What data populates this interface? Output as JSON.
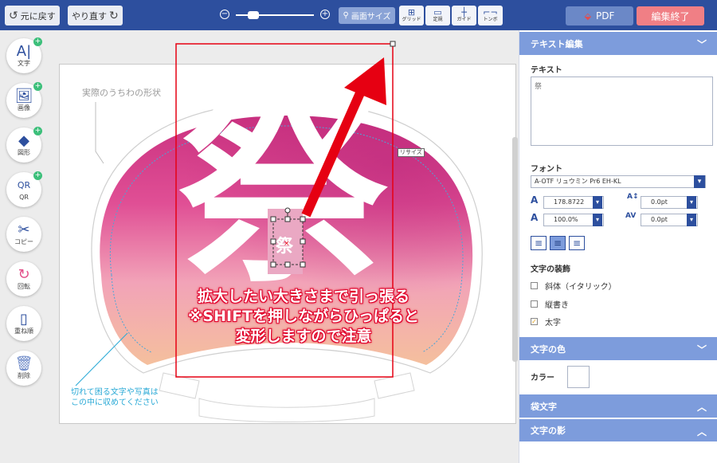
{
  "toolbar": {
    "undo": "元に戻す",
    "redo": "やり直す",
    "zoom_minus": "⊖",
    "zoom_plus": "⊕",
    "canvas_size": "画面サイズ",
    "grid": "グリッド",
    "ruler": "定規",
    "guide": "ガイド",
    "trim": "トンボ",
    "pdf": "PDF",
    "finish": "編集終了"
  },
  "left_tools": [
    {
      "glyph": "A|",
      "label": "文字",
      "plus": "+"
    },
    {
      "glyph": "🖼",
      "label": "画像",
      "plus": "+"
    },
    {
      "glyph": "◆",
      "label": "図形",
      "plus": "+"
    },
    {
      "glyph": "QR",
      "label": "QR",
      "plus": "+"
    },
    {
      "glyph": "✂",
      "label": "コピー",
      "plus": ""
    },
    {
      "glyph": "↻",
      "label": "回転",
      "plus": ""
    },
    {
      "glyph": "▯",
      "label": "重ね順",
      "plus": ""
    },
    {
      "glyph": "🗑",
      "label": "削除",
      "plus": ""
    }
  ],
  "canvas": {
    "shape_label": "実際のうちわの形状",
    "resize_tag": "リサイズ",
    "big_text": "祭",
    "selected_text": "祭",
    "warning_lines": [
      "拡大したい大きさまで引っ張る",
      "※SHIFTを押しながらひっぱると",
      "変形しますので注意"
    ],
    "cut_note_lines": [
      "切れて困る文字や写真は",
      "この中に収めてください"
    ]
  },
  "panel": {
    "text_edit_title": "テキスト編集",
    "text_label": "テキスト",
    "text_value": "祭",
    "font_label": "フォント",
    "font_value": "A-OTF リュウミン Pr6 EH-KL",
    "font_size": "178.8722",
    "letter_spacing": "0.0pt",
    "scale": "100.0%",
    "kerning": "0.0pt",
    "decoration_label": "文字の装飾",
    "italic": "斜体（イタリック）",
    "vertical": "縦書き",
    "bold": "太字",
    "color_section": "文字の色",
    "color_label": "カラー",
    "outline_section": "袋文字",
    "shadow_section": "文字の影",
    "chevron_down": "﹀",
    "chevron_up": "︿"
  },
  "colors": {
    "toolbar_bg": "#2d4f9e",
    "panel_header": "#7d9cdc",
    "finish_button": "#f07f85",
    "arrow_red": "#e60012",
    "watercolor_pink": "#d63d8a",
    "watercolor_orange": "#f2a07a"
  }
}
